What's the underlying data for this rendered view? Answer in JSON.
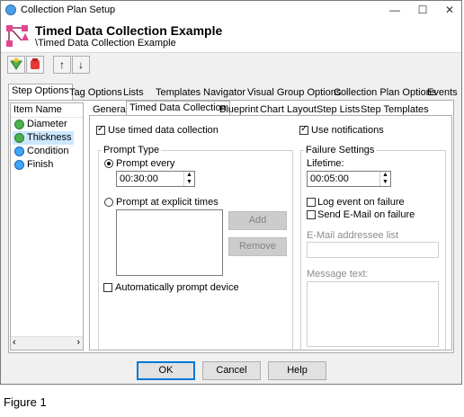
{
  "window": {
    "title": "Collection Plan Setup",
    "minimize": "—",
    "maximize": "☐",
    "close": "✕"
  },
  "header": {
    "title": "Timed Data Collection Example",
    "subtitle": "\\Timed Data Collection Example"
  },
  "toolbar": {
    "up": "↑",
    "down": "↓"
  },
  "tabs": [
    "Step Options",
    "Tag Options",
    "Lists",
    "Templates",
    "Navigator",
    "Visual Group Options",
    "Collection Plan Options",
    "Events"
  ],
  "tree": {
    "header": "Item Name",
    "items": [
      "Diameter",
      "Thickness",
      "Condition",
      "Finish"
    ],
    "scroll_left": "‹",
    "scroll_right": "›"
  },
  "subtabs": [
    "General",
    "Timed Data Collection",
    "Blueprint",
    "Chart Layout",
    "Step Lists",
    "Step Templates"
  ],
  "timed": {
    "use_timed": "Use timed data collection",
    "use_notifications": "Use notifications",
    "prompt_type": "Prompt Type",
    "prompt_every": "Prompt every",
    "prompt_every_value": "00:30:00",
    "prompt_explicit": "Prompt at explicit times",
    "add": "Add",
    "remove": "Remove",
    "auto_prompt": "Automatically prompt device",
    "failure_settings": "Failure Settings",
    "lifetime": "Lifetime:",
    "lifetime_value": "00:05:00",
    "log_event": "Log event on failure",
    "send_email": "Send E-Mail on failure",
    "email_list": "E-Mail addressee list",
    "message_text": "Message text:"
  },
  "buttons": {
    "ok": "OK",
    "cancel": "Cancel",
    "help": "Help"
  },
  "caption": "Figure 1"
}
